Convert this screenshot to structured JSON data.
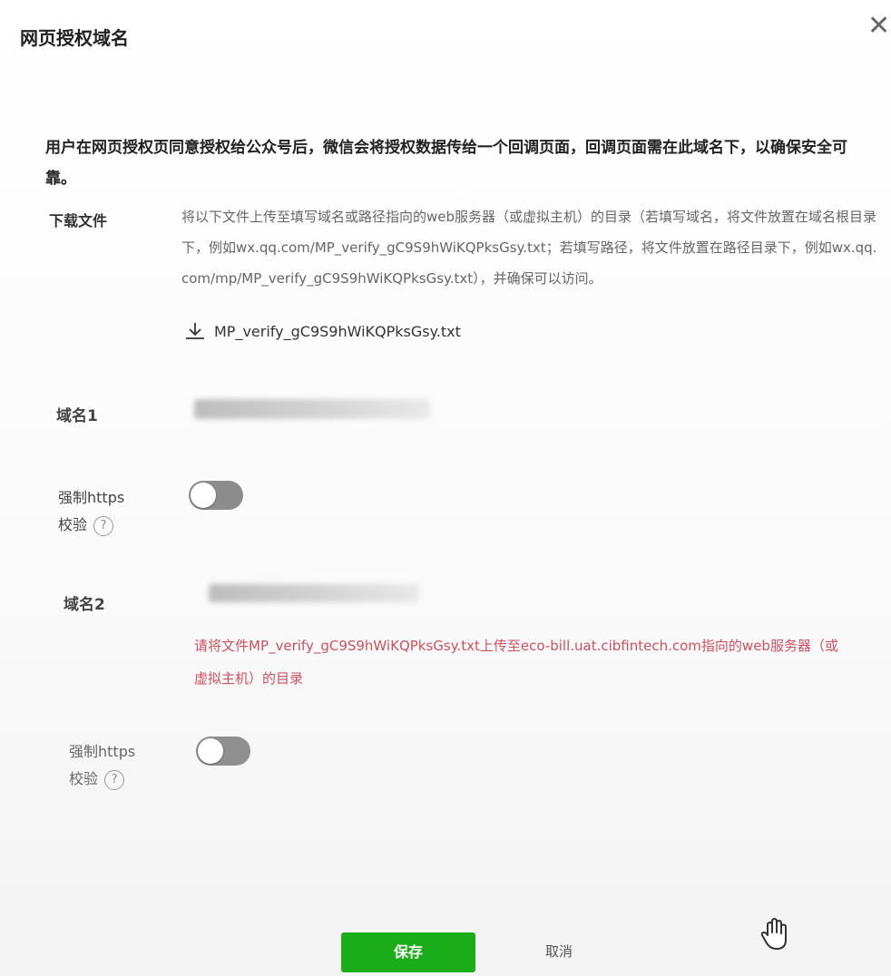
{
  "dialog": {
    "title": "网页授权域名",
    "close_symbol": "✕"
  },
  "intro_text": "用户在网页授权页同意授权给公众号后，微信会将授权数据传给一个回调页面，回调页面需在此域名下，以确保安全可靠。",
  "download": {
    "label": "下载文件",
    "description": "将以下文件上传至填写域名或路径指向的web服务器（或虚拟主机）的目录（若填写域名，将文件放置在域名根目录下，例如wx.qq.com/MP_verify_gC9S9hWiKQPksGsy.txt；若填写路径，将文件放置在路径目录下，例如wx.qq.com/mp/MP_verify_gC9S9hWiKQPksGsy.txt），并确保可以访问。",
    "file_name": "MP_verify_gC9S9hWiKQPksGsy.txt",
    "icon": "download-icon"
  },
  "domain1": {
    "label": "域名1"
  },
  "https1": {
    "label_line1": "强制https",
    "label_line2": "校验",
    "help": "?",
    "enabled": false
  },
  "domain2": {
    "label": "域名2",
    "error": "请将文件MP_verify_gC9S9hWiKQPksGsy.txt上传至eco-bill.uat.cibfintech.com指向的web服务器（或虚拟主机）的目录"
  },
  "https2": {
    "label_line1": "强制https",
    "label_line2": "校验",
    "help": "?",
    "enabled": false
  },
  "buttons": {
    "save": "保存",
    "cancel": "取消"
  },
  "colors": {
    "primary": "#1aad19",
    "error": "#d0505f",
    "toggle_off": "#8c8c8c"
  }
}
